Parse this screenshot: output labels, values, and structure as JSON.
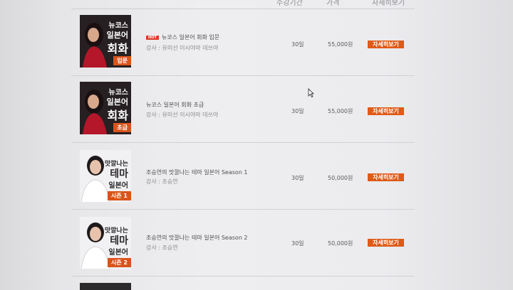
{
  "header": {
    "period_label": "수강기간",
    "price_label": "가격",
    "detail_label": "자세히보기"
  },
  "courses": [
    {
      "thumb_lines": [
        "뉴코스",
        "일본어",
        "회화"
      ],
      "badge": "입문",
      "hot": "HOT",
      "title": "뉴코스 일본어 회화 입문",
      "teacher": "강사 : 유미선 이시야마 데쓰야",
      "period": "30일",
      "price": "55,000원",
      "button": "자세히보기"
    },
    {
      "thumb_lines": [
        "뉴코스",
        "일본어",
        "회화"
      ],
      "badge": "초급",
      "title": "뉴코스 일본어 회화 초급",
      "teacher": "강사 : 유미선 이시야마 데쓰야",
      "period": "30일",
      "price": "55,000원",
      "button": "자세히보기"
    },
    {
      "thumb_lines": [
        "맛깔나는",
        "테마",
        "일본어"
      ],
      "badge": "시즌 1",
      "title": "조승연의 맛깔나는 테마 일본어 Season 1",
      "teacher": "강사 : 조승연",
      "period": "30일",
      "price": "50,000원",
      "button": "자세히보기"
    },
    {
      "thumb_lines": [
        "맛깔나는",
        "테마",
        "일본어"
      ],
      "badge": "시즌 2",
      "title": "조승연의 맛깔나는 테마 일본어 Season 2",
      "teacher": "강사 : 조승연",
      "period": "30일",
      "price": "50,000원",
      "button": "자세히보기"
    }
  ],
  "colors": {
    "accent": "#df5a16",
    "hot": "#e03a2a",
    "dark_thumb": "#262022"
  }
}
